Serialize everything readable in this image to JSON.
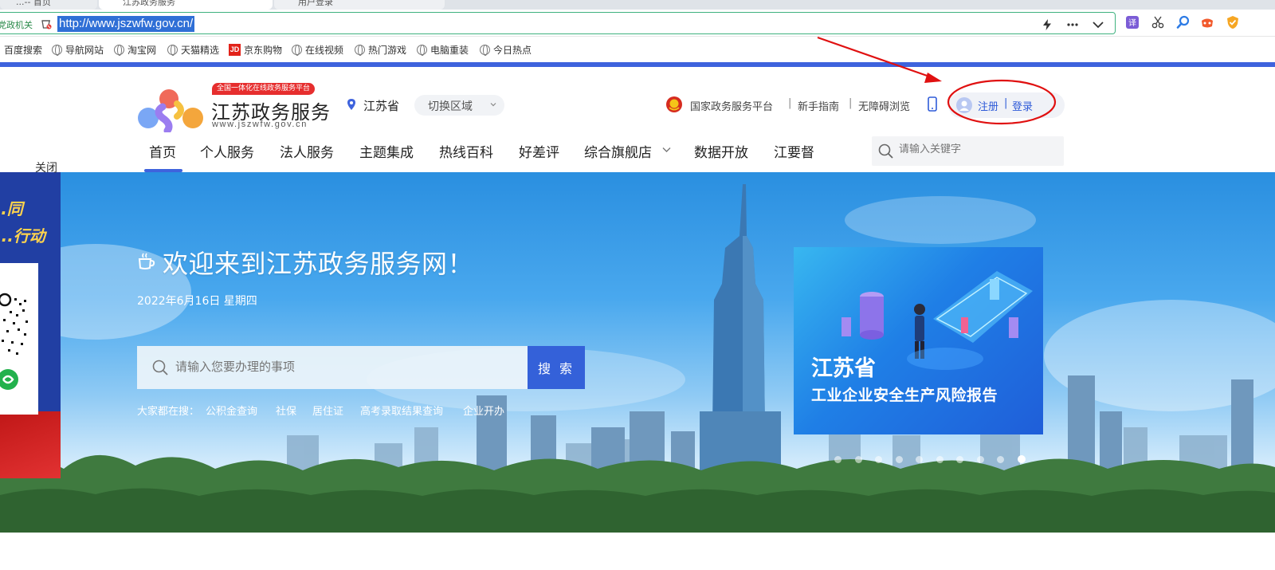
{
  "browser": {
    "tabs": [
      {
        "label": "...-- 首页"
      },
      {
        "label": "江苏政务服务"
      },
      {
        "label": "用户登录"
      }
    ],
    "url_prefix": "党政机关",
    "url": "http://www.jszwfw.gov.cn/",
    "bookmarks": [
      {
        "label": "百度搜索",
        "icon": "none"
      },
      {
        "label": "导航网站",
        "icon": "globe-icon"
      },
      {
        "label": "淘宝网",
        "icon": "globe-icon"
      },
      {
        "label": "天猫精选",
        "icon": "globe-icon"
      },
      {
        "label": "京东购物",
        "icon": "jd-icon"
      },
      {
        "label": "在线视频",
        "icon": "globe-icon"
      },
      {
        "label": "热门游戏",
        "icon": "globe-icon"
      },
      {
        "label": "电脑重装",
        "icon": "globe-icon"
      },
      {
        "label": "今日热点",
        "icon": "globe-icon"
      }
    ]
  },
  "header": {
    "slogan": "全国一体化在线政务服务平台",
    "site_name": "江苏政务服务",
    "site_domain": "www.jszwfw.gov.cn",
    "province": "江苏省",
    "switch_region": "切换区域",
    "top_links": {
      "national_platform": "国家政务服务平台",
      "sep1": "|",
      "guide": "新手指南",
      "sep2": "|",
      "accessible": "无障碍浏览"
    },
    "register": "注册",
    "login_separator": "|",
    "login": "登录",
    "search_placeholder": "请输入关键字",
    "close_ad": "关闭"
  },
  "nav": {
    "items": [
      "首页",
      "个人服务",
      "法人服务",
      "主题集成",
      "热线百科",
      "好差评",
      "综合旗舰店",
      "数据开放",
      "江要督"
    ],
    "active_index": 0
  },
  "banner": {
    "welcome": "欢迎来到江苏政务服务网！",
    "date": "2022年6月16日 星期四",
    "search_placeholder": "请输入您要办理的事项",
    "search_button": "搜 索",
    "hot_label": "大家都在搜：",
    "hot_items": [
      "公积金查询",
      "社保",
      "居住证",
      "高考录取结果查询",
      "企业开办"
    ],
    "promo_title": "江苏省",
    "promo_subtitle": "工业企业安全生产风险报告",
    "carousel_count": 10,
    "carousel_active": 9
  },
  "left_ad": {
    "line1": "...同",
    "line2": "...行动"
  },
  "colors": {
    "accent": "#3e63dd",
    "link": "#2f5bd8",
    "search_button": "#3461d9",
    "annotation": "#e01010",
    "slogan_badge": "#e62e2e"
  }
}
